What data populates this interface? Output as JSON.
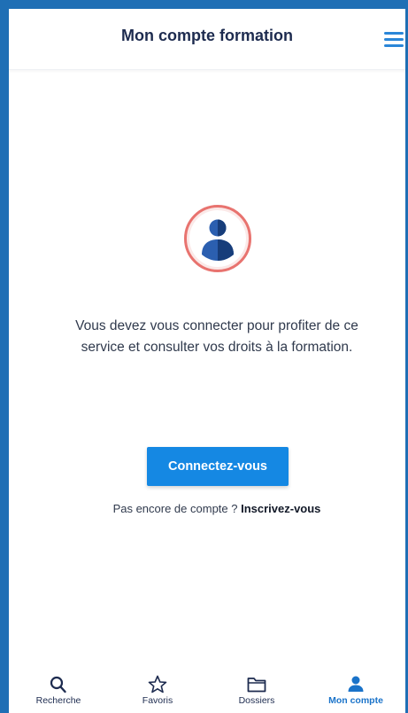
{
  "header": {
    "title": "Mon compte formation",
    "menu_icon": "hamburger-menu-icon"
  },
  "main": {
    "avatar_icon": "user-avatar-icon",
    "message": "Vous devez vous connecter pour profiter de ce service et consulter vos droits à la formation.",
    "connect_button": "Connectez-vous",
    "signup_prompt": "Pas encore de compte ? ",
    "signup_link": "Inscrivez-vous"
  },
  "tabbar": {
    "items": [
      {
        "label": "Recherche",
        "icon": "search-icon"
      },
      {
        "label": "Favoris",
        "icon": "star-icon"
      },
      {
        "label": "Dossiers",
        "icon": "folder-icon"
      },
      {
        "label": "Mon compte",
        "icon": "person-icon"
      }
    ],
    "active_index": 3
  },
  "colors": {
    "primary": "#1588e3",
    "header_text": "#1d2b4f",
    "frame": "#1f6fb5",
    "avatar_ring": "#e8736f",
    "avatar_fill": "#2b5fb0"
  }
}
